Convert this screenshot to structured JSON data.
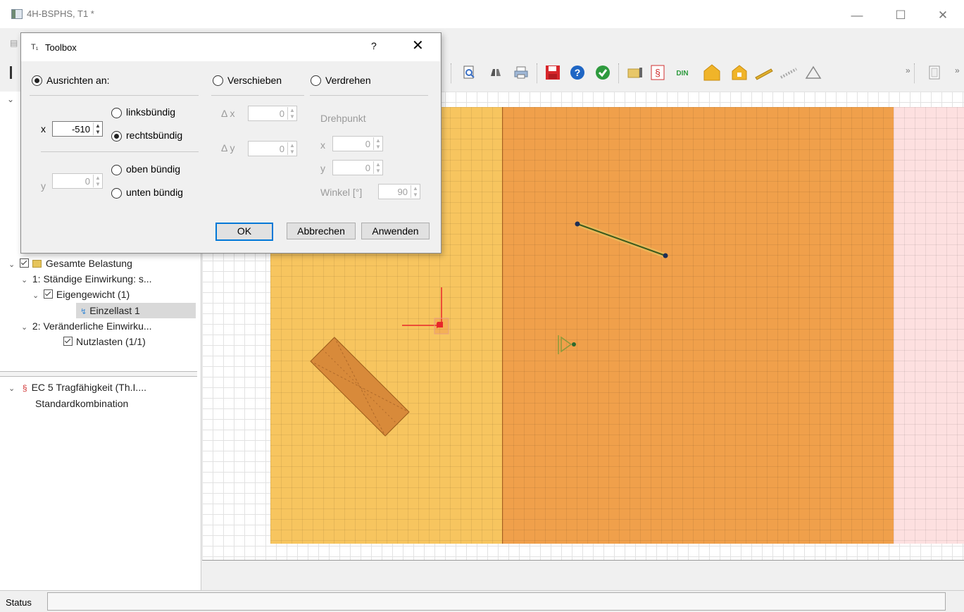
{
  "window": {
    "title": "4H-BSPHS, T1 *",
    "minimize_icon": "minimize-icon",
    "maximize_icon": "maximize-icon",
    "close_icon": "close-icon"
  },
  "menu": {
    "icon": "menu-icon"
  },
  "toolbar": {
    "icons": [
      "print-preview-icon",
      "binoculars-icon",
      "printer-icon",
      "save-icon",
      "help-icon",
      "check-icon",
      "folder-book-icon",
      "paragraph-icon",
      "din-icon",
      "house-icon",
      "house-small-icon",
      "beam-icon",
      "stairs-icon",
      "triangle-icon",
      "overflow-icon",
      "page-icon",
      "overflow-icon"
    ],
    "din_label": "DIN",
    "paragraph_label": "§",
    "more_label": "»"
  },
  "tree_loads": {
    "root": "Gesamte Belastung",
    "group1": "1: Ständige Einwirkung: s...",
    "eigengewicht": "Eigengewicht (1)",
    "einzellast": "Einzellast 1",
    "group2": "2: Veränderliche Einwirku...",
    "nutzlasten": "Nutzlasten (1/1)"
  },
  "tree_verification": {
    "standard": "EC 5 Tragfähigkeit (Th.I....",
    "combination": "Standardkombination",
    "paragraph": "§"
  },
  "dialog": {
    "title": "Toolbox",
    "help": "?",
    "close": "✕",
    "ausrichten_label": "Ausrichten an:",
    "verschieben_label": "Verschieben",
    "verdrehen_label": "Verdrehen",
    "x_label": "x",
    "x_value": "-510",
    "y_label": "y",
    "y_value": "0",
    "linksbuendig": "linksbündig",
    "rechtsbuendig": "rechtsbündig",
    "obenbuendig": "oben bündig",
    "untenbuendig": "unten bündig",
    "dx_label": "Δ x",
    "dx_value": "0",
    "dy_label": "Δ y",
    "dy_value": "0",
    "drehpunkt_label": "Drehpunkt",
    "dp_x_label": "x",
    "dp_x_value": "0",
    "dp_y_label": "y",
    "dp_y_value": "0",
    "winkel_label": "Winkel [°]",
    "winkel_value": "90",
    "ok": "OK",
    "abbrechen": "Abbrechen",
    "anwenden": "Anwenden",
    "spin_arrows": "▲▼"
  },
  "status": {
    "label": "Status",
    "value": ""
  },
  "colors": {
    "region_light": "#f7c55f",
    "region_dark": "#f0a04b",
    "region_pink": "#fde0e0",
    "load_red": "#e8262a",
    "beam": "#3b5a1c"
  }
}
